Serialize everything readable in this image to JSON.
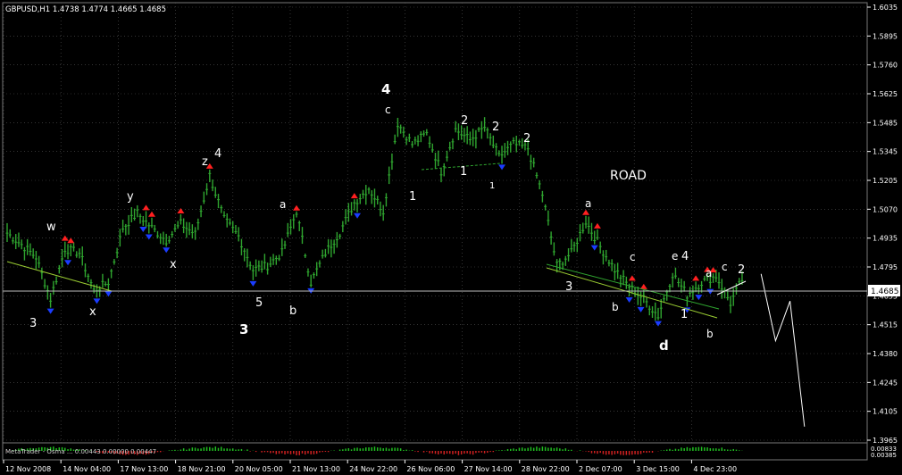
{
  "header": {
    "symbol_line": "GBPUSD,H1  1.4738 1.4774 1.4665 1.4685"
  },
  "price_axis": {
    "ticks": [
      "1.6035",
      "1.5895",
      "1.5760",
      "1.5625",
      "1.5485",
      "1.5345",
      "1.5205",
      "1.5070",
      "1.4935",
      "1.4795",
      "1.4655",
      "1.4515",
      "1.4380",
      "1.4245",
      "1.4105",
      "1.3965"
    ],
    "current_price": "1.4685",
    "subwindow_ticks": [
      "0.00833",
      "0.00385"
    ]
  },
  "time_axis": {
    "ticks": [
      "12 Nov 2008",
      "14 Nov 04:00",
      "17 Nov 13:00",
      "18 Nov 21:00",
      "20 Nov 05:00",
      "21 Nov 13:00",
      "24 Nov 22:00",
      "26 Nov 06:00",
      "27 Nov 14:00",
      "28 Nov 22:00",
      "2 Dec 07:00",
      "3 Dec 15:00",
      "4 Dec 23:00"
    ]
  },
  "indicator": {
    "text": "MetaTrader - Osma ... 0.00443 0.00000 0.00447"
  },
  "annotations": {
    "w": "w",
    "x1": "x",
    "x2": "x",
    "y": "y",
    "z": "z",
    "three_a": "3",
    "three_b": "3",
    "three_c": "3",
    "four_a": "4",
    "four_b": "4",
    "four_c": "4",
    "five": "5",
    "one_a": "1",
    "one_b": "1",
    "one_c": "1",
    "one_d": "1",
    "two_a": "2",
    "two_b": "2",
    "two_c": "2",
    "two_d": "2",
    "a1": "a",
    "a2": "a",
    "a3": "a",
    "b1": "b",
    "b2": "b",
    "b3": "b",
    "c1": "c",
    "c2": "c",
    "c3": "c",
    "d": "d",
    "e": "e",
    "road": "ROAD"
  },
  "colors": {
    "background": "#000000",
    "candle": "#2fa52f",
    "grid": "#555555",
    "fractal_up": "#ff2020",
    "fractal_down": "#1a3cff",
    "text": "#ffffff"
  },
  "chart_data": {
    "type": "candlestick",
    "symbol": "GBPUSD",
    "timeframe": "H1",
    "ylim": [
      1.3965,
      1.6035
    ],
    "x": [
      "12 Nov 2008",
      "14 Nov 04:00",
      "17 Nov 13:00",
      "18 Nov 21:00",
      "20 Nov 05:00",
      "21 Nov 13:00",
      "24 Nov 22:00",
      "26 Nov 06:00",
      "27 Nov 14:00",
      "28 Nov 22:00",
      "2 Dec 07:00",
      "3 Dec 15:00",
      "4 Dec 23:00"
    ],
    "close_path": [
      [
        0,
        1.4955
      ],
      [
        1,
        1.49
      ],
      [
        2,
        1.484
      ],
      [
        3,
        1.464
      ],
      [
        4,
        1.488
      ],
      [
        5,
        1.486
      ],
      [
        6,
        1.468
      ],
      [
        7,
        1.472
      ],
      [
        8,
        1.498
      ],
      [
        9,
        1.505
      ],
      [
        10,
        1.498
      ],
      [
        11,
        1.492
      ],
      [
        12,
        1.5
      ],
      [
        13,
        1.495
      ],
      [
        14,
        1.523
      ],
      [
        15,
        1.502
      ],
      [
        16,
        1.494
      ],
      [
        17,
        1.478
      ],
      [
        18,
        1.48
      ],
      [
        19,
        1.486
      ],
      [
        20,
        1.506
      ],
      [
        21,
        1.472
      ],
      [
        22,
        1.486
      ],
      [
        23,
        1.496
      ],
      [
        24,
        1.51
      ],
      [
        25,
        1.517
      ],
      [
        26,
        1.506
      ],
      [
        27,
        1.548
      ],
      [
        28,
        1.538
      ],
      [
        29,
        1.543
      ],
      [
        30,
        1.525
      ],
      [
        31,
        1.545
      ],
      [
        32,
        1.54
      ],
      [
        33,
        1.546
      ],
      [
        34,
        1.532
      ],
      [
        35,
        1.538
      ],
      [
        36,
        1.536
      ],
      [
        37,
        1.514
      ],
      [
        38,
        1.48
      ],
      [
        39,
        1.486
      ],
      [
        40,
        1.501
      ],
      [
        41,
        1.489
      ],
      [
        42,
        1.478
      ],
      [
        43,
        1.47
      ],
      [
        44,
        1.464
      ],
      [
        45,
        1.456
      ],
      [
        46,
        1.476
      ],
      [
        47,
        1.466
      ],
      [
        48,
        1.472
      ],
      [
        49,
        1.475
      ],
      [
        50,
        1.462
      ],
      [
        51,
        1.476
      ]
    ],
    "forecast_path": [
      [
        51,
        1.476
      ],
      [
        52,
        1.444
      ],
      [
        53,
        1.463
      ],
      [
        54,
        1.403
      ]
    ]
  }
}
